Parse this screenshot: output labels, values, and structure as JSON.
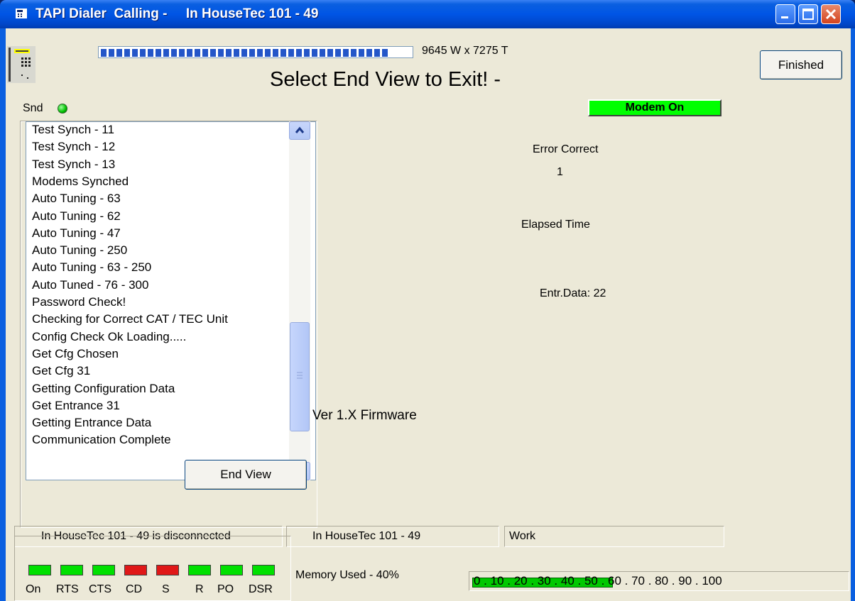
{
  "window": {
    "title": "TAPI Dialer  Calling -     In HouseTec 101 - 49"
  },
  "header": {
    "progress_fraction": 0.94,
    "dimensions": "9645 W x 7275 T",
    "headline": "Select End View to Exit! -",
    "finished_label": "Finished"
  },
  "modem_status": "Modem On",
  "snd_label": "Snd",
  "log": {
    "items": [
      "Test Synch - 11",
      "Test Synch - 12",
      "Test Synch - 13",
      "Modems Synched",
      "Auto Tuning - 63",
      "Auto Tuning - 62",
      "Auto Tuning - 47",
      "Auto Tuning - 250",
      "Auto Tuning - 63 - 250",
      "Auto Tuned - 76 - 300",
      "Password Check!",
      "Checking for Correct CAT / TEC Unit",
      "Config Check Ok Loading.....",
      "Get Cfg Chosen",
      "Get Cfg 31",
      "Getting Configuration Data",
      "Get Entrance 31",
      "Getting Entrance Data",
      "Communication Complete"
    ]
  },
  "end_view_label": "End View",
  "info": {
    "error_correct_label": "Error Correct",
    "error_correct_value": "1",
    "elapsed_time_label": "Elapsed Time",
    "entr_data": "Entr.Data: 22",
    "firmware": "Ver 1.X Firmware"
  },
  "statusbar": {
    "panel1": "In HouseTec 101 - 49 is disconnected",
    "panel2": "In HouseTec 101 - 49",
    "panel3": "Work"
  },
  "leds": [
    {
      "label": "On",
      "color": "#00e000"
    },
    {
      "label": "RTS",
      "color": "#00e000"
    },
    {
      "label": "CTS",
      "color": "#00e000"
    },
    {
      "label": "CD",
      "color": "#e01818"
    },
    {
      "label": "S",
      "color": "#e01818"
    },
    {
      "label": "R",
      "color": "#00e000"
    },
    {
      "label": "PO",
      "color": "#00e000"
    },
    {
      "label": "DSR",
      "color": "#00e000"
    }
  ],
  "memory": {
    "label": "Memory Used - 40%",
    "percent": 40,
    "scale": "0 . 10 . 20 . 30 . 40 . 50 . 60 . 70 . 80 . 90 . 100"
  }
}
